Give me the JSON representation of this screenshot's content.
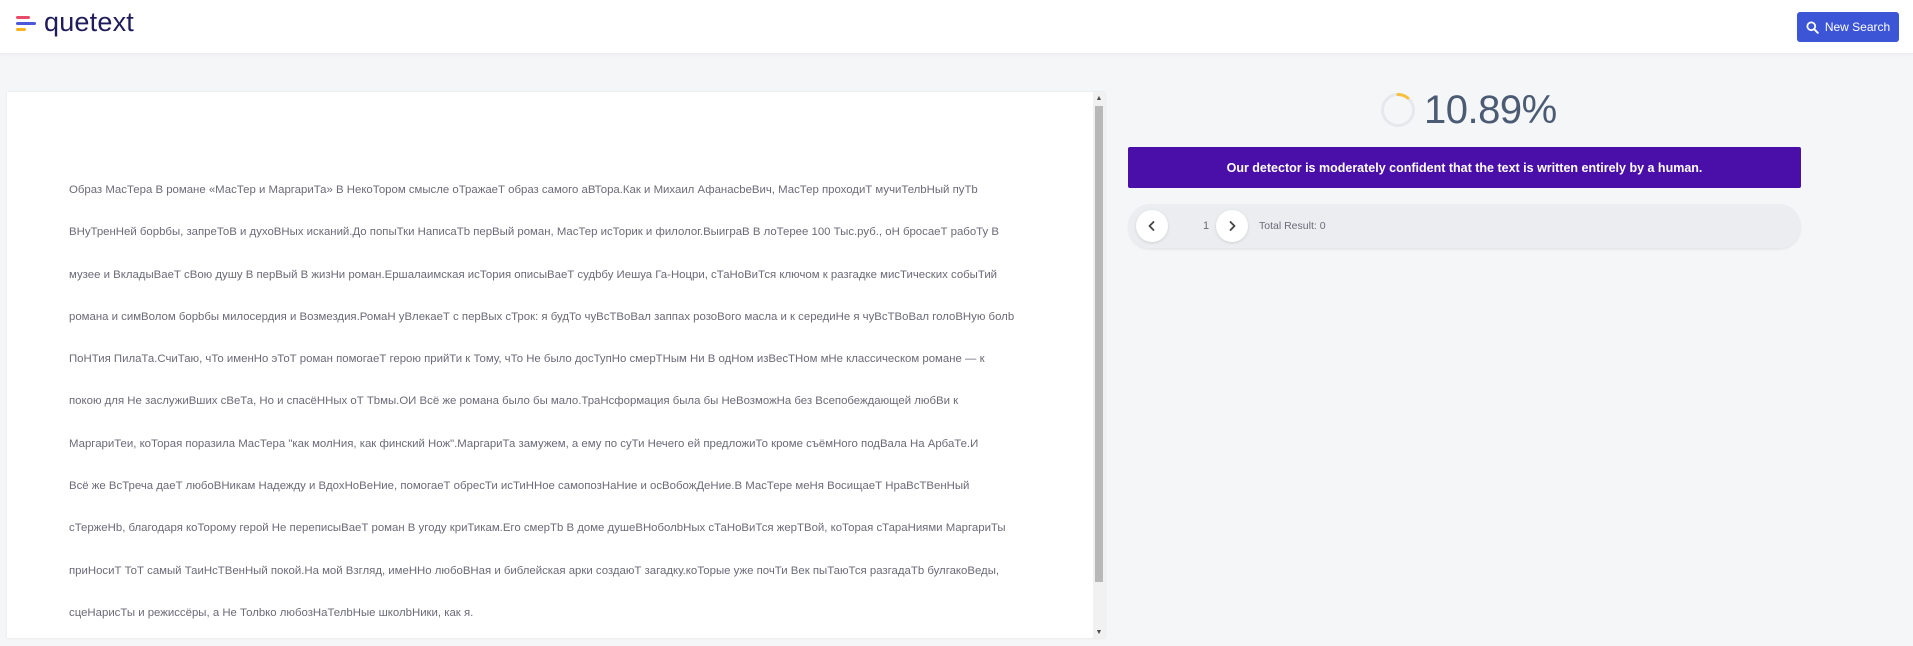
{
  "brand": {
    "name": "quetext",
    "color": "#1f1c5c",
    "mark_colors": [
      "#e94b6b",
      "#4a58d9",
      "#f6b51a"
    ]
  },
  "header": {
    "new_search_label": "New Search",
    "new_search_icon": "search-icon",
    "button_color": "#3b55d6"
  },
  "document": {
    "lines": [
      "Образ МасТера В романе «МасТер и МаргариТа» В НекоТором смысле оТражаеТ образ самого аВТора.Как и Михаил АфанасbeВич, МасТер проходиТ мучиТелbНый пуТb",
      "ВНуТренНей борbбы, запреТоВ и духоВНых исканий.До попыТки НаписаТb перВый роман, МасТер исТорик и филолог.ВыиграВ В лоТерее 100 Тыс.руб., оН бросаеТ рабоТу В",
      "музее и ВкладыВаеТ сВою душу В перВый В жизНи роман.Ершалаимская исТория описыВаеТ судbбу Иешуа Га-Ноцри, сТаНоВиТся ключом к разгадке мисТических собыТий",
      "романа и симВолом борbбы милосердия и Возмездия.РомаН уВлекаеТ с перВых сТрок: я будТо чуВсТВоВал заппах розоВого масла и к середиНе я чуВсТВоВал голоВНую болb",
      "ПоНТия ПилаТа.СчиТаю, чТо именНо эТоТ роман помогаеТ герою прийТи к Тому, чТо Не было досТупНо смерТНым Ни В одНом изВесТНом мНе классическом романе — к",
      "покою для Не заслужиВших сВеТа, Но и спасёННых оТ Тbмы.ОИ Всё же романа было бы мало.ТраНсформация была бы НеВозможНа без Всепобеждающей любВи к",
      "МаргариТеи, коТорая поразила МасТера \"как молНия, как финский Нож\".МаргариТа замужем, а ему по суТи Нечего ей предложиТо кроме съёмНого подВала На АрбаТе.И",
      "Всё же ВсТреча даеТ любоВНикам Надежду и ВдохНоВеНие, помогаеТ обресТи исТиННое самопозНаНие и осВобожДеНие.В МасТере меНя ВосищаеТ НраВсТВенНый",
      "сТержеНb, благодаря коТорому герой Не переписыВаеТ роман В угоду криТикам.Его смерТb В доме душеВНоболbНых сТаНоВиТся жерТВой, коТорая сТараНиями МаргариТы",
      "приНосиТ ТоТ самый ТаиНсТВенНый покой.На мой Взгляд, имеННо любоВНая и библейская арки создаюТ загадку.коТорые уже почТи Век пыТаюТся разгадаТb булгакоВеды,",
      "сцеНарисТы и режиссёры, а Не Толbко любозНаТелbНые школbНики, как я."
    ]
  },
  "result": {
    "score": "10.89%",
    "score_fraction": 0.1089,
    "spinner_color": "#f6c23e",
    "verdict": "Our detector is moderately confident that the text is written entirely by a human.",
    "verdict_color": "#4a0fa8",
    "pager": {
      "prev_icon": "chevron-left-icon",
      "next_icon": "chevron-right-icon",
      "page": "1",
      "total": "Total Result: 0"
    }
  }
}
